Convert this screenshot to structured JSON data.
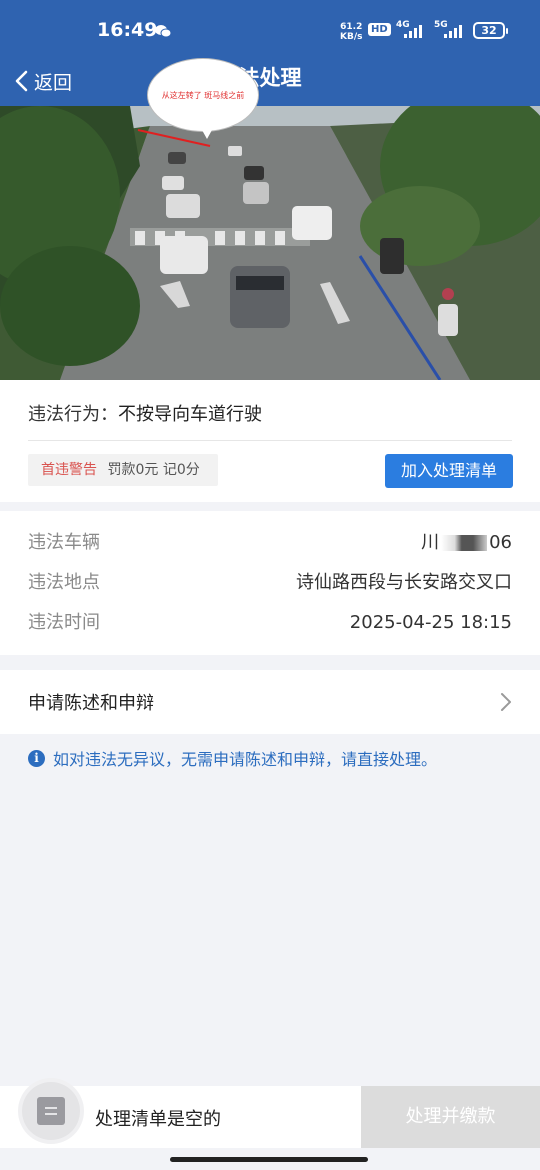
{
  "status_bar": {
    "time": "16:49",
    "net_speed_value": "61.2",
    "net_speed_unit": "KB/s",
    "hd_label": "HD",
    "sig1_label": "4G",
    "sig2_label": "5G",
    "battery": "32"
  },
  "nav": {
    "back_label": "返回",
    "title": "法处理"
  },
  "photo": {
    "annotation": "从这左转了 斑马线之前",
    "carousel_count": 3,
    "carousel_active": 3
  },
  "violation": {
    "label": "违法行为：",
    "value": "不按导向车道行驶",
    "tag_warning": "首违警告",
    "tag_fine": "罚款0元",
    "tag_points": "记0分",
    "add_button": "加入处理清单"
  },
  "details": {
    "vehicle_label": "违法车辆",
    "vehicle_value_start": "川",
    "vehicle_value_end": "06",
    "location_label": "违法地点",
    "location_value": "诗仙路西段与长安路交叉口",
    "time_label": "违法时间",
    "time_value": "2025-04-25 18:15"
  },
  "appeal": {
    "label": "申请陈述和申辩"
  },
  "notice": {
    "icon": "i",
    "text": "如对违法无异议，无需申请陈述和申辩，请直接处理。"
  },
  "bottom": {
    "empty_text": "处理清单是空的",
    "pay_button": "处理并缴款"
  },
  "colors": {
    "primary": "#2f63b0",
    "button_blue": "#2b7de0",
    "warning_red": "#d9534f",
    "disabled_gray": "#dcdcdc"
  }
}
